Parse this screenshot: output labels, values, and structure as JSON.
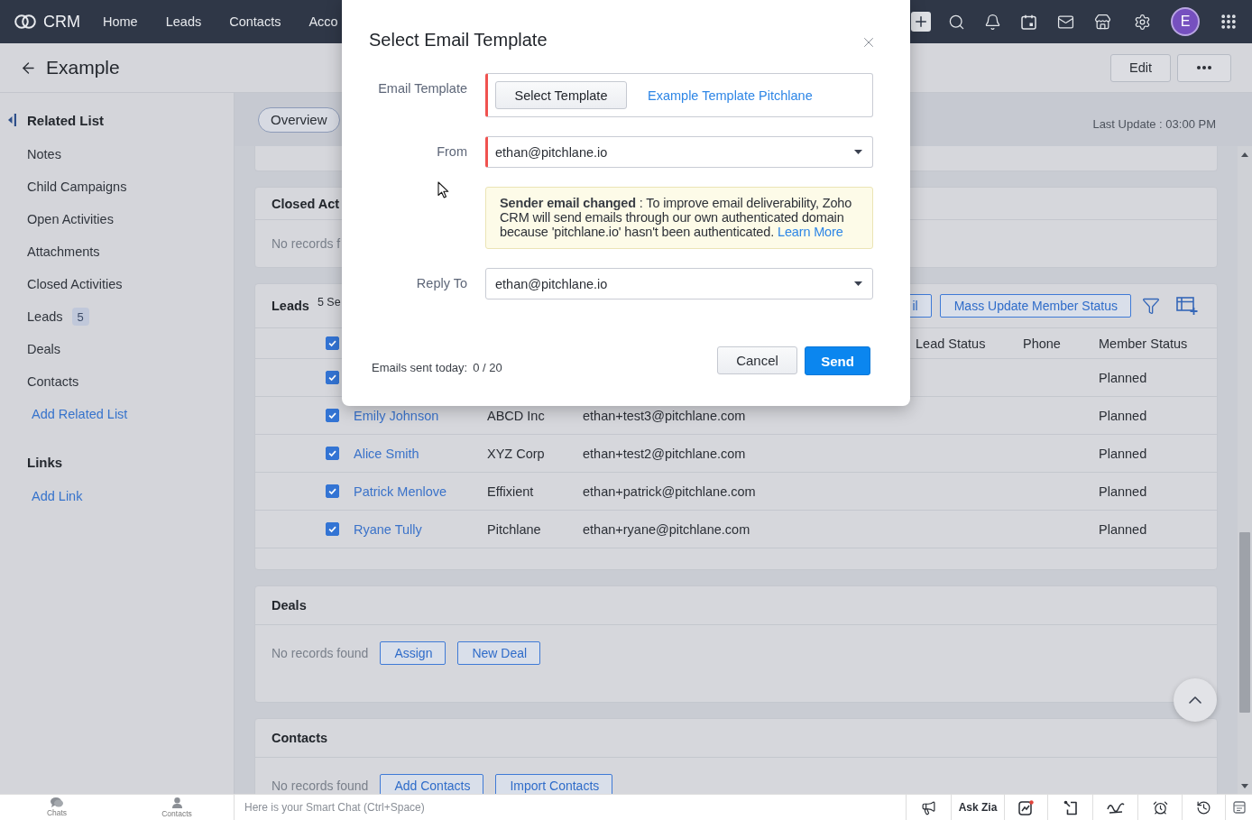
{
  "nav": {
    "logo": "CRM",
    "items": [
      "Home",
      "Leads",
      "Contacts",
      "Acco"
    ],
    "avatar": "E"
  },
  "record": {
    "title": "Example",
    "edit": "Edit"
  },
  "sidebar": {
    "heading": "Related List",
    "items": [
      {
        "label": "Notes"
      },
      {
        "label": "Child Campaigns"
      },
      {
        "label": "Open Activities"
      },
      {
        "label": "Attachments"
      },
      {
        "label": "Closed Activities"
      },
      {
        "label": "Leads",
        "count": "5"
      },
      {
        "label": "Deals"
      },
      {
        "label": "Contacts"
      }
    ],
    "add_related": "Add Related List",
    "links_heading": "Links",
    "add_link": "Add Link"
  },
  "tabs": [
    {
      "label": "Overview",
      "selected": true
    }
  ],
  "last_update": "Last Update : 03:00 PM",
  "sections": [
    {
      "kind": "blank"
    },
    {
      "kind": "empty",
      "title": "Closed Act",
      "message": "No records f"
    },
    {
      "kind": "table",
      "title": "Leads",
      "selection": "5 Se",
      "buttons": [
        "il",
        "Mass Update Member Status"
      ],
      "columns": [
        "Lead Status",
        "Phone",
        "Member Status"
      ],
      "header_checked": true,
      "rows": [
        {
          "checked": true,
          "member_status": "Planned"
        },
        {
          "checked": true,
          "name": "Emily Johnson",
          "company": "ABCD Inc",
          "email": "ethan+test3@pitchlane.com",
          "member_status": "Planned"
        },
        {
          "checked": true,
          "name": "Alice Smith",
          "company": "XYZ Corp",
          "email": "ethan+test2@pitchlane.com",
          "member_status": "Planned"
        },
        {
          "checked": true,
          "name": "Patrick Menlove",
          "company": "Effixient",
          "email": "ethan+patrick@pitchlane.com",
          "member_status": "Planned"
        },
        {
          "checked": true,
          "name": "Ryane Tully",
          "company": "Pitchlane",
          "email": "ethan+ryane@pitchlane.com",
          "member_status": "Planned"
        }
      ]
    },
    {
      "kind": "empty",
      "title": "Deals",
      "message": "No records found",
      "buttons": [
        "Assign",
        "New Deal"
      ]
    },
    {
      "kind": "empty",
      "title": "Contacts",
      "message": "No records found",
      "buttons": [
        "Add Contacts",
        "Import Contacts"
      ]
    }
  ],
  "modal": {
    "title": "Select Email Template",
    "fields": [
      {
        "kind": "template",
        "label": "Email Template",
        "required": true,
        "button": "Select Template",
        "value": "Example Template Pitchlane"
      },
      {
        "kind": "select",
        "label": "From",
        "required": true,
        "value": "ethan@pitchlane.io"
      },
      {
        "kind": "notice",
        "text": "**Sender email changed** : To improve email deliverability, Zoho CRM will send emails through our own authenticated domain because 'pitchlane.io' hasn't been authenticated.",
        "link": "Learn More"
      },
      {
        "kind": "select",
        "label": "Reply To",
        "required": false,
        "value": "ethan@pitchlane.io"
      }
    ],
    "sent_label": "Emails sent today:",
    "sent_count": "0 / 20",
    "buttons": [
      {
        "kind": "secondary",
        "label": "Cancel"
      },
      {
        "kind": "primary",
        "label": "Send"
      }
    ]
  },
  "bottom_bar": {
    "apps": [
      "Chats",
      "Contacts"
    ],
    "chat_placeholder": "Here is your Smart Chat (Ctrl+Space)",
    "ask_zia": "Ask Zia"
  }
}
